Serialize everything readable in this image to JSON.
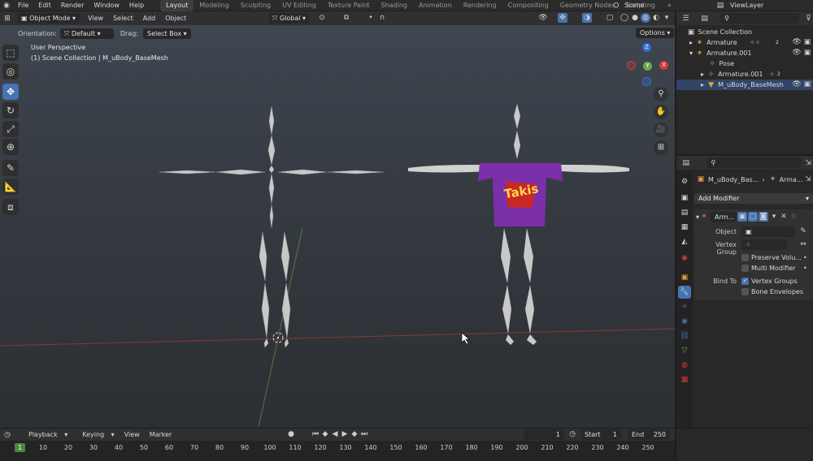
{
  "topbar": {
    "menus": [
      "File",
      "Edit",
      "Render",
      "Window",
      "Help"
    ],
    "workspaces": [
      "Layout",
      "Modeling",
      "Sculpting",
      "UV Editing",
      "Texture Paint",
      "Shading",
      "Animation",
      "Rendering",
      "Compositing",
      "Geometry Nodes",
      "Scripting"
    ],
    "active_workspace": "Layout",
    "add_workspace": "+",
    "scene": "Scene",
    "view_layer": "ViewLayer"
  },
  "viewport_header": {
    "mode": "Object Mode",
    "menus": [
      "View",
      "Select",
      "Add",
      "Object"
    ],
    "transform_orientation": "Global"
  },
  "tool_settings": {
    "orientation_label": "Orientation:",
    "orientation_value": "Default",
    "drag_label": "Drag:",
    "drag_value": "Select Box",
    "options": "Options"
  },
  "viewport": {
    "view_name": "User Perspective",
    "collection_path": "(1) Scene Collection | M_uBody_BaseMesh",
    "shirt_text": "Takis",
    "gizmo_axes": [
      "Z",
      "Y",
      "X"
    ]
  },
  "outliner": {
    "rows": [
      {
        "label": "Scene Collection",
        "icon": "collection-icon"
      },
      {
        "label": "Armature",
        "icon": "armature-icon",
        "badge": "2"
      },
      {
        "label": "Armature.001",
        "icon": "armature-icon"
      },
      {
        "label": "Pose",
        "icon": "pose-icon"
      },
      {
        "label": "Armature.001",
        "icon": "armature-data-icon",
        "badge": "2"
      },
      {
        "label": "M_uBody_BaseMesh",
        "icon": "mesh-icon"
      }
    ]
  },
  "properties": {
    "breadcrumb_object": "M_uBody_Bas...",
    "breadcrumb_modifier": "Arma...",
    "add_modifier": "Add Modifier",
    "modifier_name": "Arm...",
    "object_label": "Object",
    "vertex_group_label": "Vertex Group",
    "preserve_volume": "Preserve Volu...",
    "multi_modifier": "Multi Modifier",
    "bind_to_label": "Bind To",
    "vertex_groups": "Vertex Groups",
    "bone_envelopes": "Bone Envelopes"
  },
  "timeline": {
    "menus": [
      "Playback",
      "Keying",
      "View",
      "Marker"
    ],
    "current_frame": "1",
    "start_label": "Start",
    "start_value": "1",
    "end_label": "End",
    "end_value": "250",
    "ruler": [
      "1",
      "10",
      "20",
      "30",
      "40",
      "50",
      "60",
      "70",
      "80",
      "90",
      "100",
      "110",
      "120",
      "130",
      "140",
      "150",
      "160",
      "170",
      "180",
      "190",
      "200",
      "210",
      "220",
      "230",
      "240",
      "250"
    ]
  },
  "colors": {
    "accent": "#4772b3",
    "viewport_top": "#3f4650",
    "viewport_bottom": "#2a2d31",
    "shirt": "#7b2fa8",
    "x_axis": "#c0392b",
    "y_axis": "#6aa84f"
  }
}
